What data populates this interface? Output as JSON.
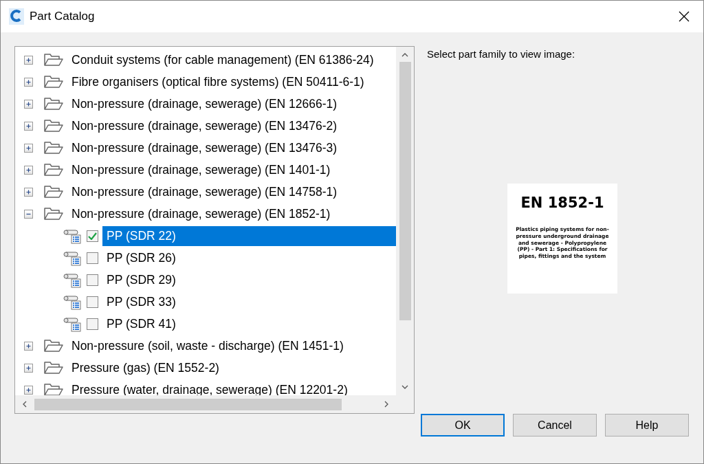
{
  "window": {
    "title": "Part Catalog"
  },
  "tree": {
    "items": [
      {
        "label": "Conduit systems (for cable management) (EN 61386-24)",
        "expanded": false
      },
      {
        "label": "Fibre organisers (optical fibre systems) (EN 50411-6-1)",
        "expanded": false
      },
      {
        "label": "Non-pressure (drainage, sewerage) (EN 12666-1)",
        "expanded": false
      },
      {
        "label": "Non-pressure (drainage, sewerage) (EN 13476-2)",
        "expanded": false
      },
      {
        "label": "Non-pressure (drainage, sewerage) (EN 13476-3)",
        "expanded": false
      },
      {
        "label": "Non-pressure (drainage, sewerage) (EN 1401-1)",
        "expanded": false
      },
      {
        "label": "Non-pressure (drainage, sewerage) (EN 14758-1)",
        "expanded": false
      },
      {
        "label": "Non-pressure (drainage, sewerage) (EN 1852-1)",
        "expanded": true,
        "children": [
          {
            "label": "PP (SDR 22)",
            "checked": true,
            "selected": true
          },
          {
            "label": "PP (SDR 26)",
            "checked": false,
            "selected": false
          },
          {
            "label": "PP (SDR 29)",
            "checked": false,
            "selected": false
          },
          {
            "label": "PP (SDR 33)",
            "checked": false,
            "selected": false
          },
          {
            "label": "PP (SDR 41)",
            "checked": false,
            "selected": false
          }
        ]
      },
      {
        "label": "Non-pressure (soil, waste - discharge) (EN 1451-1)",
        "expanded": false
      },
      {
        "label": "Pressure (gas) (EN 1552-2)",
        "expanded": false
      },
      {
        "label": "Pressure (water, drainage, sewerage) (EN 12201-2)",
        "expanded": false
      }
    ]
  },
  "preview": {
    "label": "Select part family to view image:",
    "image": {
      "title": "EN 1852-1",
      "description": "Plastics piping systems for non-pressure underground drainage and sewerage - Polypropylene (PP) - Part 1: Specifications for pipes, fittings and the system"
    }
  },
  "buttons": [
    {
      "label": "OK",
      "default": true
    },
    {
      "label": "Cancel",
      "default": false
    },
    {
      "label": "Help",
      "default": false
    }
  ]
}
